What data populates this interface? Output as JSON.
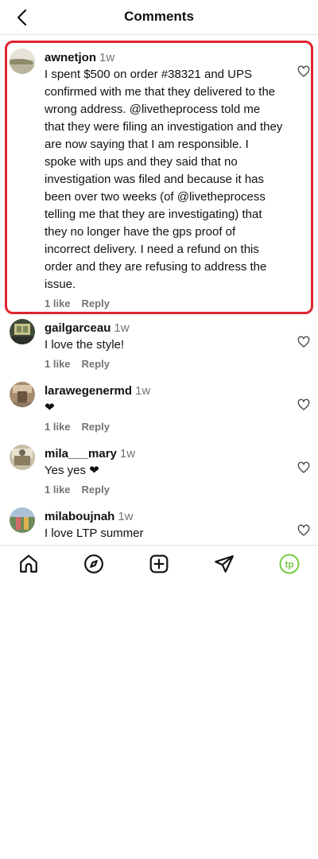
{
  "header": {
    "title": "Comments",
    "back_icon": "chevron-left-icon"
  },
  "comments": [
    {
      "username": "awnetjon",
      "time": "1w",
      "text": "I spent $500 on order #38321 and UPS confirmed with me that they delivered to the wrong address. @livetheprocess told me that they were filing an investigation and they are now saying that I am responsible. I spoke with ups and they said that no investigation was filed and because it has been over two weeks (of @livetheprocess telling me that they are investigating) that they no longer have the gps proof of incorrect delivery. I need a refund on this order and they are refusing to address the issue.",
      "likes": "1 like",
      "reply": "Reply",
      "highlighted": true
    },
    {
      "username": "gailgarceau",
      "time": "1w",
      "text": "I love the style!",
      "likes": "1 like",
      "reply": "Reply"
    },
    {
      "username": "larawegenermd",
      "time": "1w",
      "text": "❤",
      "likes": "1 like",
      "reply": "Reply"
    },
    {
      "username": "mila___mary",
      "time": "1w",
      "text": "Yes yes ❤",
      "likes": "1 like",
      "reply": "Reply"
    },
    {
      "username": "milaboujnah",
      "time": "1w",
      "text": "I love LTP summer"
    }
  ],
  "tabbar": {
    "items": [
      "home-icon",
      "explore-compass-icon",
      "create-plus-icon",
      "direct-send-icon",
      "profile-avatar-icon"
    ],
    "profile_badge_text": "tp"
  },
  "colors": {
    "highlight_border": "#e0242f",
    "secondary_text": "#737373",
    "profile_badge": "#7ac943"
  }
}
